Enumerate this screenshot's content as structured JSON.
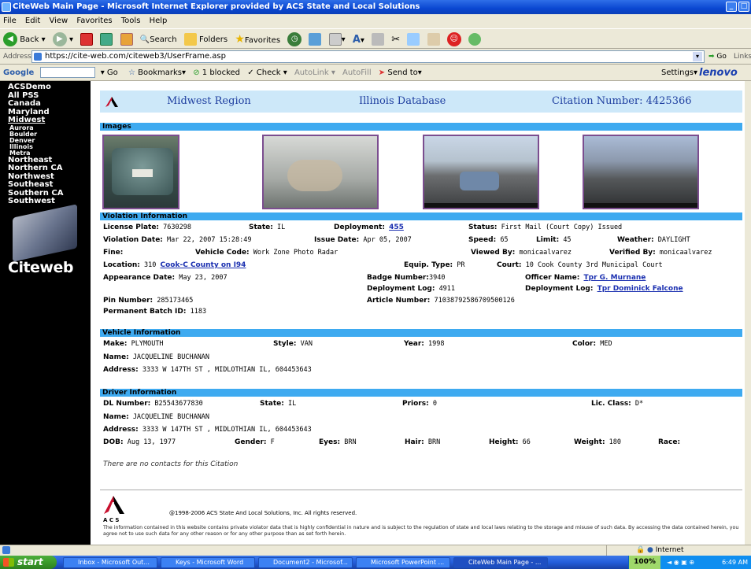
{
  "window": {
    "title": "CiteWeb Main Page - Microsoft Internet Explorer provided by ACS State and Local Solutions"
  },
  "menu": [
    "File",
    "Edit",
    "View",
    "Favorites",
    "Tools",
    "Help"
  ],
  "toolbar": {
    "back": "Back",
    "search": "Search",
    "folders": "Folders",
    "favorites": "Favorites"
  },
  "address": {
    "label": "Address",
    "url": "https://cite-web.com/citeweb3/UserFrame.asp",
    "go": "Go",
    "links": "Links"
  },
  "google_toolbar": {
    "brand": "Google",
    "go": "Go",
    "bookmarks": "Bookmarks",
    "blocked": "1 blocked",
    "check": "Check",
    "autolink": "AutoLink",
    "autofill": "AutoFill",
    "send_to": "Send to",
    "settings": "Settings",
    "lenovo": "lenovo"
  },
  "sidebar": {
    "regions": [
      "ACSDemo",
      "All PSS",
      "Canada",
      "Maryland",
      "Midwest"
    ],
    "sub_items": [
      "Aurora",
      "Boulder",
      "Denver",
      "Illinois",
      "Metra"
    ],
    "regions_after": [
      "Northeast",
      "Northern CA",
      "Northwest",
      "Southeast",
      "Southern CA",
      "Southwest"
    ],
    "logo_text": "Citeweb"
  },
  "header": {
    "region": "Midwest Region",
    "database": "Illinois Database",
    "citation": "Citation Number: 4425366"
  },
  "sections": {
    "images": "Images",
    "violation": "Violation Information",
    "vehicle": "Vehicle Information",
    "driver": "Driver Information"
  },
  "violation": {
    "license_plate_label": "License Plate:",
    "license_plate": "7630298",
    "state_label": "State:",
    "state": "IL",
    "deployment_label": "Deployment:",
    "deployment": "455",
    "status_label": "Status:",
    "status": "First Mail (Court Copy) Issued",
    "violation_date_label": "Violation Date:",
    "violation_date": "Mar 22, 2007 15:28:49",
    "issue_date_label": "Issue Date:",
    "issue_date": "Apr 05, 2007",
    "speed_label": "Speed:",
    "speed": "65",
    "limit_label": "Limit:",
    "limit": "45",
    "weather_label": "Weather:",
    "weather": "DAYLIGHT",
    "fine_label": "Fine:",
    "vehicle_code_label": "Vehicle Code:",
    "vehicle_code": "Work Zone Photo Radar",
    "viewed_by_label": "Viewed By:",
    "viewed_by": "monicaalvarez",
    "verified_by_label": "Verified By:",
    "verified_by": "monicaalvarez",
    "location_label": "Location:",
    "location_code": "310",
    "location_link": "Cook-C County on I94",
    "equip_type_label": "Equip. Type:",
    "equip_type": "PR",
    "court_label": "Court:",
    "court": "10  Cook County 3rd Municipal Court",
    "appearance_date_label": "Appearance Date:",
    "appearance_date": "May 23, 2007",
    "badge_label": "Badge Number:",
    "badge": "3940",
    "officer_label": "Officer Name:",
    "officer": "Tpr G. Murnane",
    "deployment_log_label": "Deployment Log:",
    "deployment_log": "4911",
    "deployment_log2_label": "Deployment Log:",
    "deployment_log2": "Tpr Dominick Falcone",
    "pin_label": "Pin Number:",
    "pin": "285173465",
    "article_label": "Article Number:",
    "article": "71038792586709500126",
    "batch_label": "Permanent Batch ID:",
    "batch": "1183"
  },
  "vehicle": {
    "make_label": "Make:",
    "make": "PLYMOUTH",
    "style_label": "Style:",
    "style": "VAN",
    "year_label": "Year:",
    "year": "1998",
    "color_label": "Color:",
    "color": "MED",
    "name_label": "Name:",
    "name": "JACQUELINE  BUCHANAN",
    "address_label": "Address:",
    "address": "3333 W 147TH ST  , MIDLOTHIAN  IL, 604453643"
  },
  "driver": {
    "dl_label": "DL Number:",
    "dl": "B25543677830",
    "state_label": "State:",
    "state": "IL",
    "priors_label": "Priors:",
    "priors": "0",
    "lic_class_label": "Lic. Class:",
    "lic_class": "D*",
    "name_label": "Name:",
    "name": "JACQUELINE  BUCHANAN",
    "address_label": "Address:",
    "address": "3333 W 147TH ST  , MIDLOTHIAN  IL, 604453643",
    "dob_label": "DOB:",
    "dob": "Aug 13, 1977",
    "gender_label": "Gender:",
    "gender": "F",
    "eyes_label": "Eyes:",
    "eyes": "BRN",
    "hair_label": "Hair:",
    "hair": "BRN",
    "height_label": "Height:",
    "height": "66",
    "weight_label": "Weight:",
    "weight": "180",
    "race_label": "Race:"
  },
  "contacts_note": "There are no contacts for this Citation",
  "footer": {
    "logo_letters": "A  C  S",
    "copyright": "@1998-2006 ACS State And Local Solutions, Inc. All rights reserved.",
    "disclaimer": "The information contained in this website contains private violator data that is highly confidential in nature and is subject to the regulation of state and local laws relating to the storage and misuse of such data. By accessing the data contained herein, you agree not to use such data for any other reason or for any other purpose than as set forth herein."
  },
  "statusbar": {
    "zone": "Internet"
  },
  "taskbar": {
    "start": "start",
    "items": [
      "Inbox - Microsoft Out...",
      "Keys - Microsoft Word",
      "Document2 - Microsof...",
      "Microsoft PowerPoint ...",
      "CiteWeb Main Page - ..."
    ],
    "zoom": "100%",
    "clock": "6:49 AM"
  }
}
